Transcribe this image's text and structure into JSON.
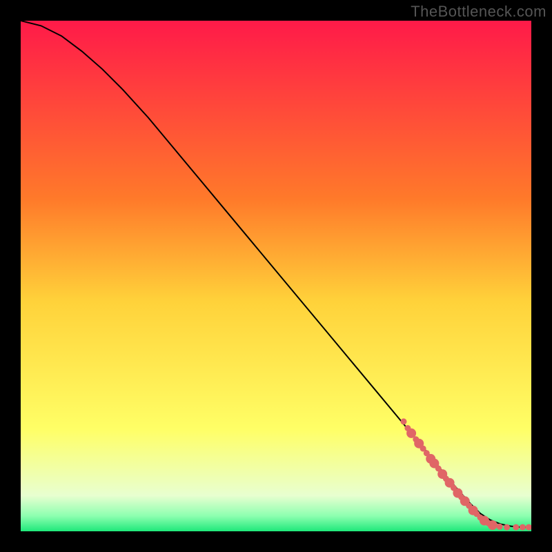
{
  "watermark": "TheBottleneck.com",
  "chart_data": {
    "type": "line",
    "title": "",
    "xlabel": "",
    "ylabel": "",
    "xlim": [
      0,
      100
    ],
    "ylim": [
      0,
      100
    ],
    "grid": false,
    "legend": false,
    "gradient_stops": [
      {
        "offset": 0,
        "color": "#ff1a49"
      },
      {
        "offset": 35,
        "color": "#ff7a2a"
      },
      {
        "offset": 55,
        "color": "#ffd23a"
      },
      {
        "offset": 80,
        "color": "#ffff66"
      },
      {
        "offset": 93,
        "color": "#e8ffd0"
      },
      {
        "offset": 97,
        "color": "#8dffb0"
      },
      {
        "offset": 100,
        "color": "#1fe87a"
      }
    ],
    "curve": {
      "name": "bottleneck-curve",
      "color": "#000000",
      "x": [
        0,
        4,
        8,
        12,
        16,
        20,
        25,
        30,
        35,
        40,
        45,
        50,
        55,
        60,
        65,
        70,
        75,
        80,
        84,
        88,
        90,
        92,
        94,
        96,
        98,
        100
      ],
      "y": [
        100,
        99,
        97,
        94,
        90.5,
        86.5,
        81,
        75,
        69,
        63,
        57,
        51,
        45,
        39,
        33,
        27,
        21,
        15,
        10,
        5.5,
        3.5,
        2.2,
        1.4,
        1.0,
        0.8,
        0.8
      ]
    },
    "markers": {
      "name": "scatter-overlay",
      "color": "#e06666",
      "radius_small": 4.5,
      "radius_large": 7,
      "points": [
        {
          "x": 75.0,
          "y": 21.5,
          "r": "small"
        },
        {
          "x": 75.8,
          "y": 20.2,
          "r": "small"
        },
        {
          "x": 76.5,
          "y": 19.2,
          "r": "large"
        },
        {
          "x": 77.4,
          "y": 18.0,
          "r": "small"
        },
        {
          "x": 78.0,
          "y": 17.2,
          "r": "large"
        },
        {
          "x": 78.8,
          "y": 16.2,
          "r": "small"
        },
        {
          "x": 79.5,
          "y": 15.3,
          "r": "small"
        },
        {
          "x": 80.3,
          "y": 14.2,
          "r": "large"
        },
        {
          "x": 81.0,
          "y": 13.3,
          "r": "large"
        },
        {
          "x": 81.8,
          "y": 12.3,
          "r": "small"
        },
        {
          "x": 82.6,
          "y": 11.2,
          "r": "large"
        },
        {
          "x": 83.3,
          "y": 10.3,
          "r": "small"
        },
        {
          "x": 84.0,
          "y": 9.5,
          "r": "large"
        },
        {
          "x": 84.8,
          "y": 8.5,
          "r": "small"
        },
        {
          "x": 85.6,
          "y": 7.5,
          "r": "large"
        },
        {
          "x": 86.3,
          "y": 6.7,
          "r": "small"
        },
        {
          "x": 87.0,
          "y": 5.9,
          "r": "large"
        },
        {
          "x": 87.8,
          "y": 5.0,
          "r": "small"
        },
        {
          "x": 88.6,
          "y": 4.1,
          "r": "large"
        },
        {
          "x": 89.3,
          "y": 3.4,
          "r": "small"
        },
        {
          "x": 90.0,
          "y": 2.7,
          "r": "small"
        },
        {
          "x": 90.8,
          "y": 2.1,
          "r": "large"
        },
        {
          "x": 91.6,
          "y": 1.6,
          "r": "small"
        },
        {
          "x": 92.4,
          "y": 1.2,
          "r": "large"
        },
        {
          "x": 93.8,
          "y": 0.9,
          "r": "small"
        },
        {
          "x": 95.2,
          "y": 0.8,
          "r": "small"
        },
        {
          "x": 97.0,
          "y": 0.8,
          "r": "small"
        },
        {
          "x": 98.3,
          "y": 0.8,
          "r": "small"
        },
        {
          "x": 99.5,
          "y": 0.8,
          "r": "small"
        }
      ]
    }
  }
}
